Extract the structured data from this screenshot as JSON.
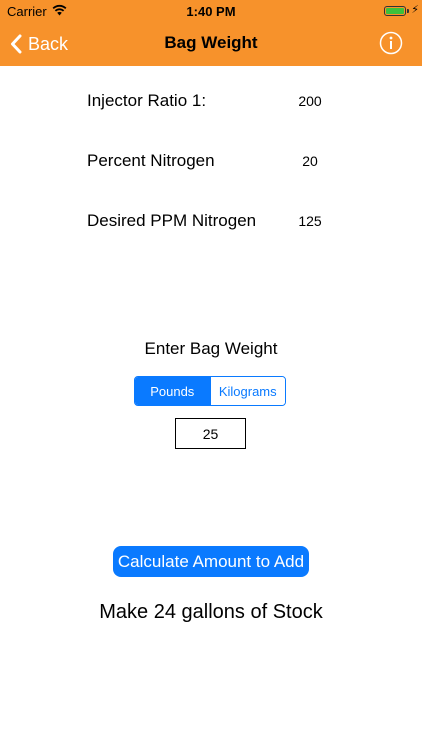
{
  "status_bar": {
    "carrier": "Carrier",
    "time": "1:40 PM",
    "battery_color": "#3CC13B"
  },
  "nav": {
    "back_label": "Back",
    "title": "Bag Weight",
    "info_icon": "info-icon",
    "bar_color": "#F7922B"
  },
  "params": [
    {
      "label": "Injector Ratio 1:",
      "value": "200"
    },
    {
      "label": "Percent Nitrogen",
      "value": "20"
    },
    {
      "label": "Desired PPM Nitrogen",
      "value": "125"
    }
  ],
  "bag_weight": {
    "label": "Enter Bag Weight",
    "units": [
      {
        "label": "Pounds",
        "selected": true
      },
      {
        "label": "Kilograms",
        "selected": false
      }
    ],
    "value": "25"
  },
  "calculate": {
    "label": "Calculate Amount to Add",
    "color": "#0A7AFF"
  },
  "result": {
    "text": "Make 24 gallons of Stock"
  }
}
